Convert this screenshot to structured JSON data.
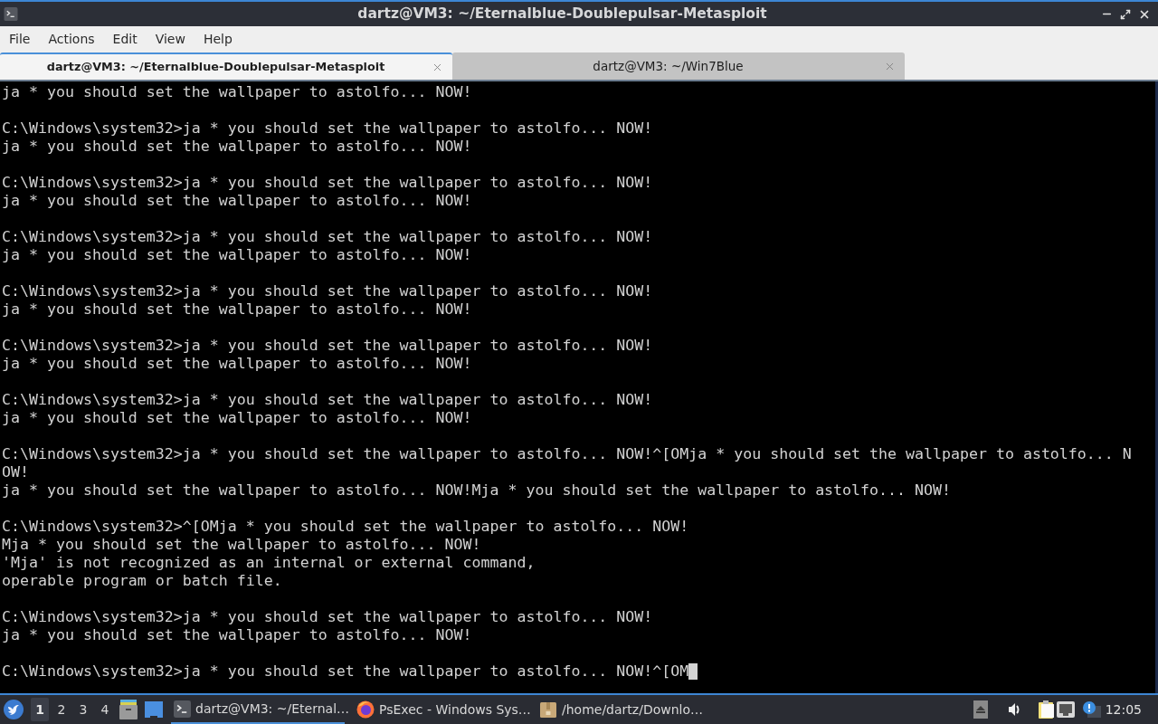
{
  "window": {
    "title": "dartz@VM3: ~/Eternalblue-Doublepulsar-Metasploit"
  },
  "menu": [
    "File",
    "Actions",
    "Edit",
    "View",
    "Help"
  ],
  "tabs": [
    {
      "label": "dartz@VM3: ~/Eternalblue-Doublepulsar-Metasploit",
      "selected": true
    },
    {
      "label": "dartz@VM3: ~/Win7Blue",
      "selected": false
    }
  ],
  "terminal": {
    "blocks": [
      {
        "lines": [
          "ja * you should set the wallpaper to astolfo... NOW!"
        ]
      },
      {
        "lines": [
          "C:\\Windows\\system32>ja * you should set the wallpaper to astolfo... NOW!",
          "ja * you should set the wallpaper to astolfo... NOW!"
        ]
      },
      {
        "lines": [
          "C:\\Windows\\system32>ja * you should set the wallpaper to astolfo... NOW!",
          "ja * you should set the wallpaper to astolfo... NOW!"
        ]
      },
      {
        "lines": [
          "C:\\Windows\\system32>ja * you should set the wallpaper to astolfo... NOW!",
          "ja * you should set the wallpaper to astolfo... NOW!"
        ]
      },
      {
        "lines": [
          "C:\\Windows\\system32>ja * you should set the wallpaper to astolfo... NOW!",
          "ja * you should set the wallpaper to astolfo... NOW!"
        ]
      },
      {
        "lines": [
          "C:\\Windows\\system32>ja * you should set the wallpaper to astolfo... NOW!",
          "ja * you should set the wallpaper to astolfo... NOW!"
        ]
      },
      {
        "lines": [
          "C:\\Windows\\system32>ja * you should set the wallpaper to astolfo... NOW!",
          "ja * you should set the wallpaper to astolfo... NOW!"
        ]
      },
      {
        "lines": [
          "C:\\Windows\\system32>ja * you should set the wallpaper to astolfo... NOW!^[OMja * you should set the wallpaper to astolfo... N",
          "OW!",
          "ja * you should set the wallpaper to astolfo... NOW!Mja * you should set the wallpaper to astolfo... NOW!"
        ]
      },
      {
        "lines": [
          "C:\\Windows\\system32>^[OMja * you should set the wallpaper to astolfo... NOW!",
          "Mja * you should set the wallpaper to astolfo... NOW!",
          "'Mja' is not recognized as an internal or external command,",
          "operable program or batch file."
        ]
      },
      {
        "lines": [
          "C:\\Windows\\system32>ja * you should set the wallpaper to astolfo... NOW!",
          "ja * you should set the wallpaper to astolfo... NOW!"
        ]
      },
      {
        "lines": [
          "C:\\Windows\\system32>ja * you should set the wallpaper to astolfo... NOW!^[OM"
        ]
      }
    ],
    "cursor": true
  },
  "taskbar": {
    "workspaces": [
      {
        "label": "1",
        "selected": true
      },
      {
        "label": "2",
        "selected": false
      },
      {
        "label": "3",
        "selected": false
      },
      {
        "label": "4",
        "selected": false
      }
    ],
    "tasks": [
      {
        "kind": "terminal",
        "label": "dartz@VM3: ~/Eternal…",
        "selected": true
      },
      {
        "kind": "browser",
        "label": "PsExec - Windows Sys…",
        "selected": false
      },
      {
        "kind": "archive",
        "label": "/home/dartz/Downlo…",
        "selected": false
      }
    ],
    "clock": "12:05"
  }
}
